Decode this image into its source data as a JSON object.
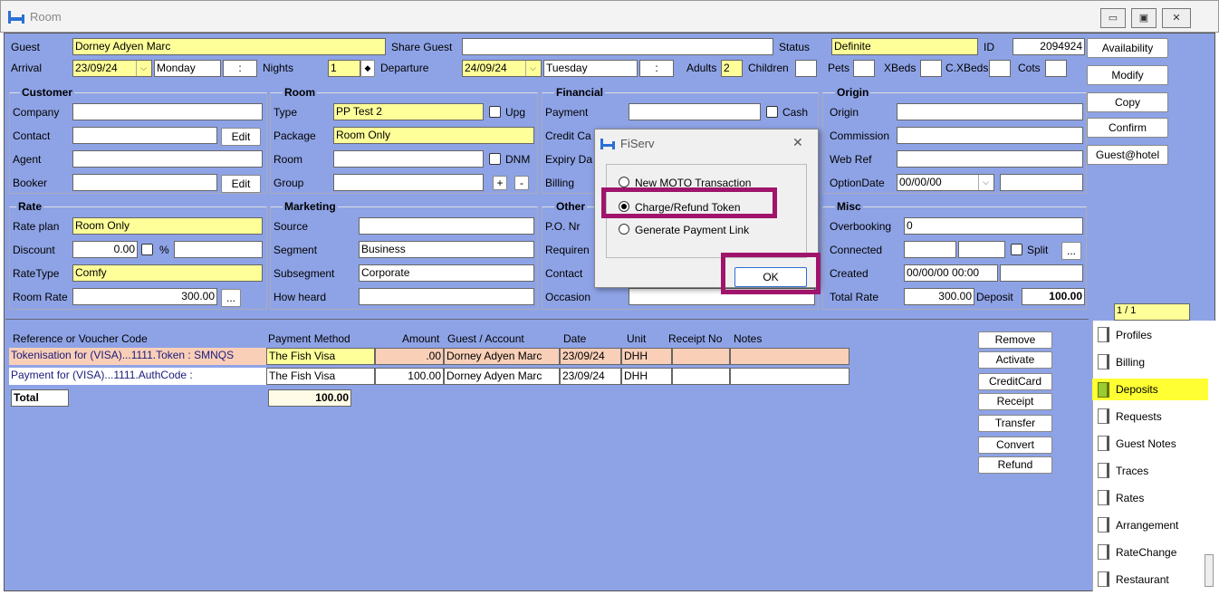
{
  "window": {
    "title": "Room",
    "min": "▭",
    "max": "▣",
    "close": "✕"
  },
  "guest": {
    "guest_label": "Guest",
    "guest_value": "Dorney Adyen Marc",
    "share_label": "Share Guest",
    "status_label": "Status",
    "status_value": "Definite",
    "id_label": "ID",
    "id_value": "2094924"
  },
  "arrival": {
    "label": "Arrival",
    "date": "23/09/24",
    "day": "Monday",
    "time": ":",
    "nights_label": "Nights",
    "nights": "1",
    "departure_label": "Departure",
    "dep_date": "24/09/24",
    "dep_day": "Tuesday",
    "dep_time": ":",
    "adults_label": "Adults",
    "adults": "2",
    "children_label": "Children",
    "pets_label": "Pets",
    "xbeds_label": "XBeds",
    "cxbeds_label": "C.XBeds",
    "cots_label": "Cots"
  },
  "customer": {
    "heading": "Customer",
    "company": "Company",
    "contact": "Contact",
    "agent": "Agent",
    "booker": "Booker",
    "edit": "Edit"
  },
  "room": {
    "heading": "Room",
    "type_label": "Type",
    "type_value": "PP Test 2",
    "upg": "Upg",
    "package_label": "Package",
    "package_value": "Room Only",
    "room_label": "Room",
    "dnm": "DNM",
    "group_label": "Group",
    "plus": "+",
    "minus": "-"
  },
  "financial": {
    "heading": "Financial",
    "payment": "Payment",
    "cash": "Cash",
    "credit": "Credit Ca",
    "expiry": "Expiry Da",
    "billing": "Billing"
  },
  "origin": {
    "heading": "Origin",
    "origin": "Origin",
    "commission": "Commission",
    "webref": "Web Ref",
    "optiondate_label": "OptionDate",
    "optiondate": "00/00/00"
  },
  "rate": {
    "heading": "Rate",
    "plan_label": "Rate plan",
    "plan_value": "Room Only",
    "discount_label": "Discount",
    "discount_value": "0.00",
    "pct": "%",
    "ratetype_label": "RateType",
    "ratetype_value": "Comfy",
    "roomrate_label": "Room Rate",
    "roomrate_value": "300.00",
    "dots": "..."
  },
  "marketing": {
    "heading": "Marketing",
    "source": "Source",
    "segment_label": "Segment",
    "segment_value": "Business",
    "subsegment_label": "Subsegment",
    "subsegment_value": "Corporate",
    "howheard": "How heard"
  },
  "other": {
    "heading": "Other",
    "po": "P.O. Nr",
    "requirements": "Requiren",
    "contact": "Contact",
    "occasion": "Occasion"
  },
  "misc": {
    "heading": "Misc",
    "overbooking_label": "Overbooking",
    "overbooking": "0",
    "connected": "Connected",
    "split": "Split",
    "dots": "...",
    "created_label": "Created",
    "created": "00/00/00 00:00",
    "totalrate_label": "Total Rate",
    "totalrate": "300.00",
    "deposit_label": "Deposit",
    "deposit": "100.00",
    "pager": "1 / 1"
  },
  "sidebar": {
    "availability": "Availability",
    "modify": "Modify",
    "copy": "Copy",
    "confirm": "Confirm",
    "guesthotel": "Guest@hotel"
  },
  "table": {
    "headers": [
      "Reference or Voucher Code",
      "Payment Method",
      "Amount",
      "Guest / Account",
      "Date",
      "Unit",
      "Receipt No",
      "Notes"
    ],
    "rows": [
      {
        "ref": "Tokenisation for (VISA)...1111.Token : SMNQS",
        "method": "The Fish Visa",
        "amount": ".00",
        "guest": "Dorney Adyen Marc",
        "date": "23/09/24",
        "unit": "DHH"
      },
      {
        "ref": "Payment for (VISA)...1111.AuthCode :",
        "method": "The Fish Visa",
        "amount": "100.00",
        "guest": "Dorney Adyen Marc",
        "date": "23/09/24",
        "unit": "DHH"
      }
    ],
    "total_label": "Total",
    "total_value": "100.00"
  },
  "actions": [
    "Remove",
    "Activate",
    "CreditCard",
    "Receipt",
    "Transfer",
    "Convert",
    "Refund"
  ],
  "tabs": [
    "Profiles",
    "Billing",
    "Deposits",
    "Requests",
    "Guest Notes",
    "Traces",
    "Rates",
    "Arrangement",
    "RateChange",
    "Restaurant"
  ],
  "dialog": {
    "title": "FiServ",
    "close": "✕",
    "options": [
      "New MOTO Transaction",
      "Charge/Refund Token",
      "Generate Payment Link"
    ],
    "ok": "OK"
  },
  "colors": {
    "form_bg": "#8ea3e6",
    "highlight": "#a0156b",
    "yellow": "#ffff99"
  }
}
